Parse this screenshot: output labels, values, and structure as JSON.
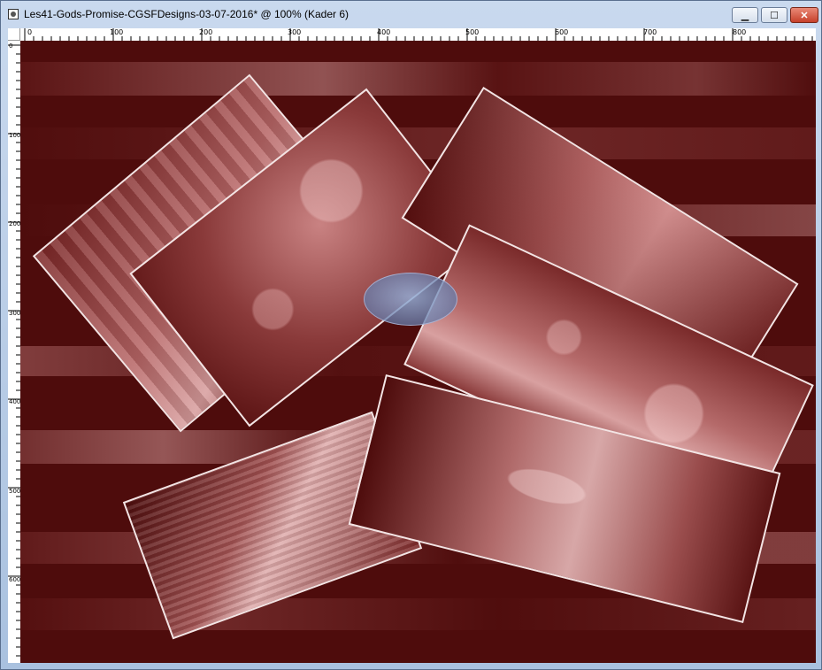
{
  "window": {
    "title": "Les41-Gods-Promise-CGSFDesigns-03-07-2016* @ 100% (Kader 6)",
    "buttons": {
      "minimize": "▁",
      "maximize": "☐",
      "close": "✕"
    }
  },
  "ruler": {
    "top_labels": [
      "0",
      "100",
      "200",
      "300",
      "400",
      "500",
      "600",
      "700",
      "800"
    ],
    "left_labels": [
      "0",
      "100",
      "200",
      "300",
      "400",
      "500",
      "600"
    ]
  },
  "canvas": {
    "background": "#4e0c0c",
    "accent": "#c98282",
    "frame_color": "#f3e4e4"
  },
  "icons": {
    "app": "paint-document-icon",
    "watermark": "logo-watermark"
  }
}
